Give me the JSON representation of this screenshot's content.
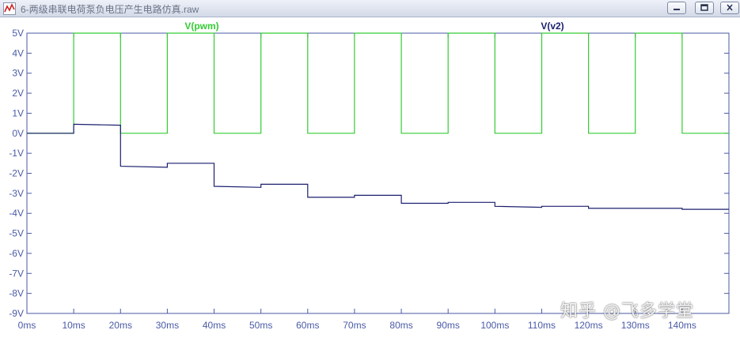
{
  "window": {
    "title": "6-两级串联电荷泵负电压产生电路仿真.raw",
    "icon": "waveform-icon"
  },
  "watermark": {
    "text": "知乎 @飞多学堂"
  },
  "colors": {
    "pwm": "#33cc33",
    "v2": "#1a1f6e",
    "axis": "#4a5aa6",
    "grid": "#6b7bb8"
  },
  "chart_data": {
    "type": "line",
    "title": "",
    "xlabel": "",
    "ylabel": "",
    "xlim": [
      0,
      150
    ],
    "ylim": [
      -9,
      5
    ],
    "x_unit": "ms",
    "xticks": [
      0,
      10,
      20,
      30,
      40,
      50,
      60,
      70,
      80,
      90,
      100,
      110,
      120,
      130,
      140
    ],
    "xtick_labels": [
      "0ms",
      "10ms",
      "20ms",
      "30ms",
      "40ms",
      "50ms",
      "60ms",
      "70ms",
      "80ms",
      "90ms",
      "100ms",
      "110ms",
      "120ms",
      "130ms",
      "140ms"
    ],
    "yticks": [
      5,
      4,
      3,
      2,
      1,
      0,
      -1,
      -2,
      -3,
      -4,
      -5,
      -6,
      -7,
      -8,
      -9
    ],
    "ytick_labels": [
      "5V",
      "4V",
      "3V",
      "2V",
      "1V",
      "0V",
      "-1V",
      "-2V",
      "-3V",
      "-4V",
      "-5V",
      "-6V",
      "-7V",
      "-8V",
      "-9V"
    ],
    "grid": false,
    "series": [
      {
        "name": "V(pwm)",
        "color": "#33cc33",
        "x": [
          0,
          10,
          10,
          20,
          20,
          30,
          30,
          40,
          40,
          50,
          50,
          60,
          60,
          70,
          70,
          80,
          80,
          90,
          90,
          100,
          100,
          110,
          110,
          120,
          120,
          130,
          130,
          140,
          140,
          150
        ],
        "y": [
          0,
          0,
          5,
          5,
          0,
          0,
          5,
          5,
          0,
          0,
          5,
          5,
          0,
          0,
          5,
          5,
          0,
          0,
          5,
          5,
          0,
          0,
          5,
          5,
          0,
          0,
          5,
          5,
          0,
          0
        ]
      },
      {
        "name": "V(v2)",
        "color": "#1a1f6e",
        "x": [
          0,
          10,
          10,
          20,
          20,
          30,
          30,
          40,
          40,
          50,
          50,
          60,
          60,
          70,
          70,
          80,
          80,
          90,
          90,
          100,
          100,
          110,
          110,
          120,
          120,
          130,
          130,
          140,
          140,
          150
        ],
        "y": [
          0,
          0,
          0.45,
          0.4,
          -1.65,
          -1.7,
          -1.5,
          -1.5,
          -2.65,
          -2.7,
          -2.55,
          -2.55,
          -3.2,
          -3.2,
          -3.1,
          -3.1,
          -3.5,
          -3.5,
          -3.45,
          -3.45,
          -3.65,
          -3.7,
          -3.65,
          -3.65,
          -3.75,
          -3.75,
          -3.75,
          -3.75,
          -3.8,
          -3.8
        ]
      }
    ]
  }
}
